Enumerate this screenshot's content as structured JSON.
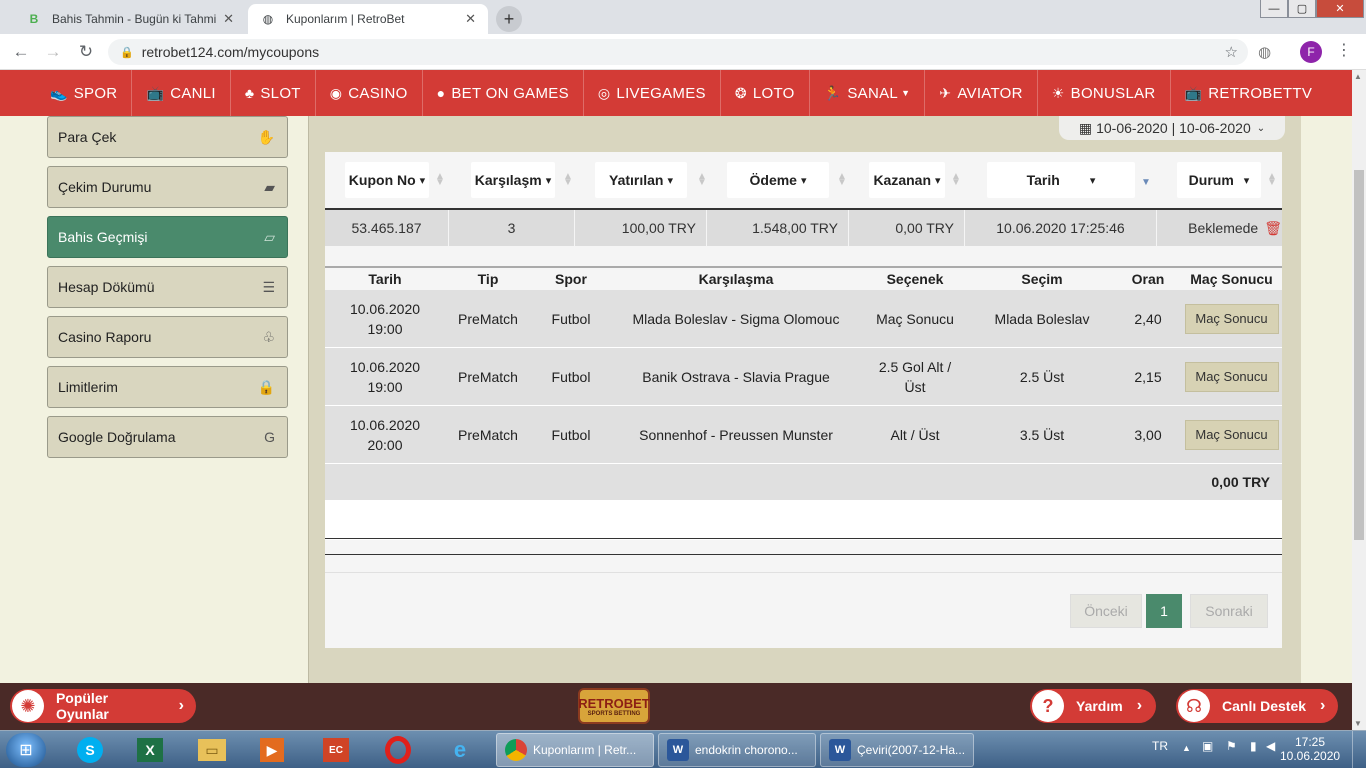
{
  "browser": {
    "tabs": [
      {
        "title": "Bahis Tahmin - Bugün ki Tahmin",
        "favicon": "letter-b"
      },
      {
        "title": "Kuponlarım | RetroBet",
        "favicon": "globe-icon"
      }
    ],
    "url": "retrobet124.com/mycoupons",
    "profile_initial": "F"
  },
  "site_nav": [
    {
      "label": "SPOR",
      "icon": "shoe-icon"
    },
    {
      "label": "CANLI",
      "icon": "tv-icon"
    },
    {
      "label": "SLOT",
      "icon": "cherry-icon"
    },
    {
      "label": "CASINO",
      "icon": "chip-icon"
    },
    {
      "label": "BET ON GAMES",
      "icon": "ball-icon"
    },
    {
      "label": "LIVEGAMES",
      "icon": "wheel-icon"
    },
    {
      "label": "LOTO",
      "icon": "lottery-icon"
    },
    {
      "label": "SANAL",
      "icon": "runner-icon"
    },
    {
      "label": "AVIATOR",
      "icon": "plane-icon"
    },
    {
      "label": "BONUSLAR",
      "icon": "bulb-icon"
    },
    {
      "label": "RETROBETTV",
      "icon": "tv-icon"
    }
  ],
  "sidebar": [
    {
      "label": "Para Çek",
      "icon": "hand-coin-icon",
      "active": false
    },
    {
      "label": "Çekim Durumu",
      "icon": "wallet-icon",
      "active": false
    },
    {
      "label": "Bahis Geçmişi",
      "icon": "ticket-icon",
      "active": true
    },
    {
      "label": "Hesap Dökümü",
      "icon": "list-icon",
      "active": false
    },
    {
      "label": "Casino Raporu",
      "icon": "cherry-icon",
      "active": false
    },
    {
      "label": "Limitlerim",
      "icon": "lock-icon",
      "active": false
    },
    {
      "label": "Google Doğrulama",
      "icon": "google-icon",
      "active": false
    }
  ],
  "date_range": "10-06-2020 | 10-06-2020",
  "filters": [
    {
      "label": "Kupon No"
    },
    {
      "label": "Karşılaşm"
    },
    {
      "label": "Yatırılan"
    },
    {
      "label": "Ödeme"
    },
    {
      "label": "Kazanan"
    },
    {
      "label": "Tarih"
    },
    {
      "label": "Durum"
    }
  ],
  "coupon": {
    "no": "53.465.187",
    "matches": "3",
    "stake": "100,00 TRY",
    "payout": "1.548,00 TRY",
    "won": "0,00 TRY",
    "date": "10.06.2020 17:25:46",
    "status": "Beklemede"
  },
  "detail_headers": [
    "Tarih",
    "Tip",
    "Spor",
    "Karşılaşma",
    "Seçenek",
    "Seçim",
    "Oran",
    "Maç Sonucu"
  ],
  "detail_rows": [
    {
      "date": "10.06.2020",
      "time": "19:00",
      "type": "PreMatch",
      "sport": "Futbol",
      "match": "Mlada Boleslav - Sigma Olomouc",
      "option": "Maç Sonucu",
      "pick": "Mlada Boleslav",
      "odds": "2,40",
      "result_btn": "Maç Sonucu"
    },
    {
      "date": "10.06.2020",
      "time": "19:00",
      "type": "PreMatch",
      "sport": "Futbol",
      "match": "Banik Ostrava - Slavia Prague",
      "option": "2.5 Gol Alt / Üst",
      "pick": "2.5 Üst",
      "odds": "2,15",
      "result_btn": "Maç Sonucu"
    },
    {
      "date": "10.06.2020",
      "time": "20:00",
      "type": "PreMatch",
      "sport": "Futbol",
      "match": "Sonnenhof - Preussen Munster",
      "option": "Alt / Üst",
      "pick": "3.5 Üst",
      "odds": "3,00",
      "result_btn": "Maç Sonucu"
    }
  ],
  "total": "0,00 TRY",
  "pager": {
    "prev": "Önceki",
    "current": "1",
    "next": "Sonraki"
  },
  "footer": {
    "popular": "Popüler Oyunlar",
    "help": "Yardım",
    "live_support": "Canlı Destek",
    "logo_text": "RETROBET",
    "logo_sub": "SPORTS BETTING"
  },
  "taskbar": {
    "tasks": [
      {
        "label": "Kuponlarım | Retr...",
        "icon": "chrome-icon",
        "active": true
      },
      {
        "label": "endokrin chorono...",
        "icon": "word-icon",
        "active": false
      },
      {
        "label": "Çeviri(2007-12-Ha...",
        "icon": "word-icon",
        "active": false
      }
    ],
    "lang": "TR",
    "time": "17:25",
    "date": "10.06.2020"
  }
}
